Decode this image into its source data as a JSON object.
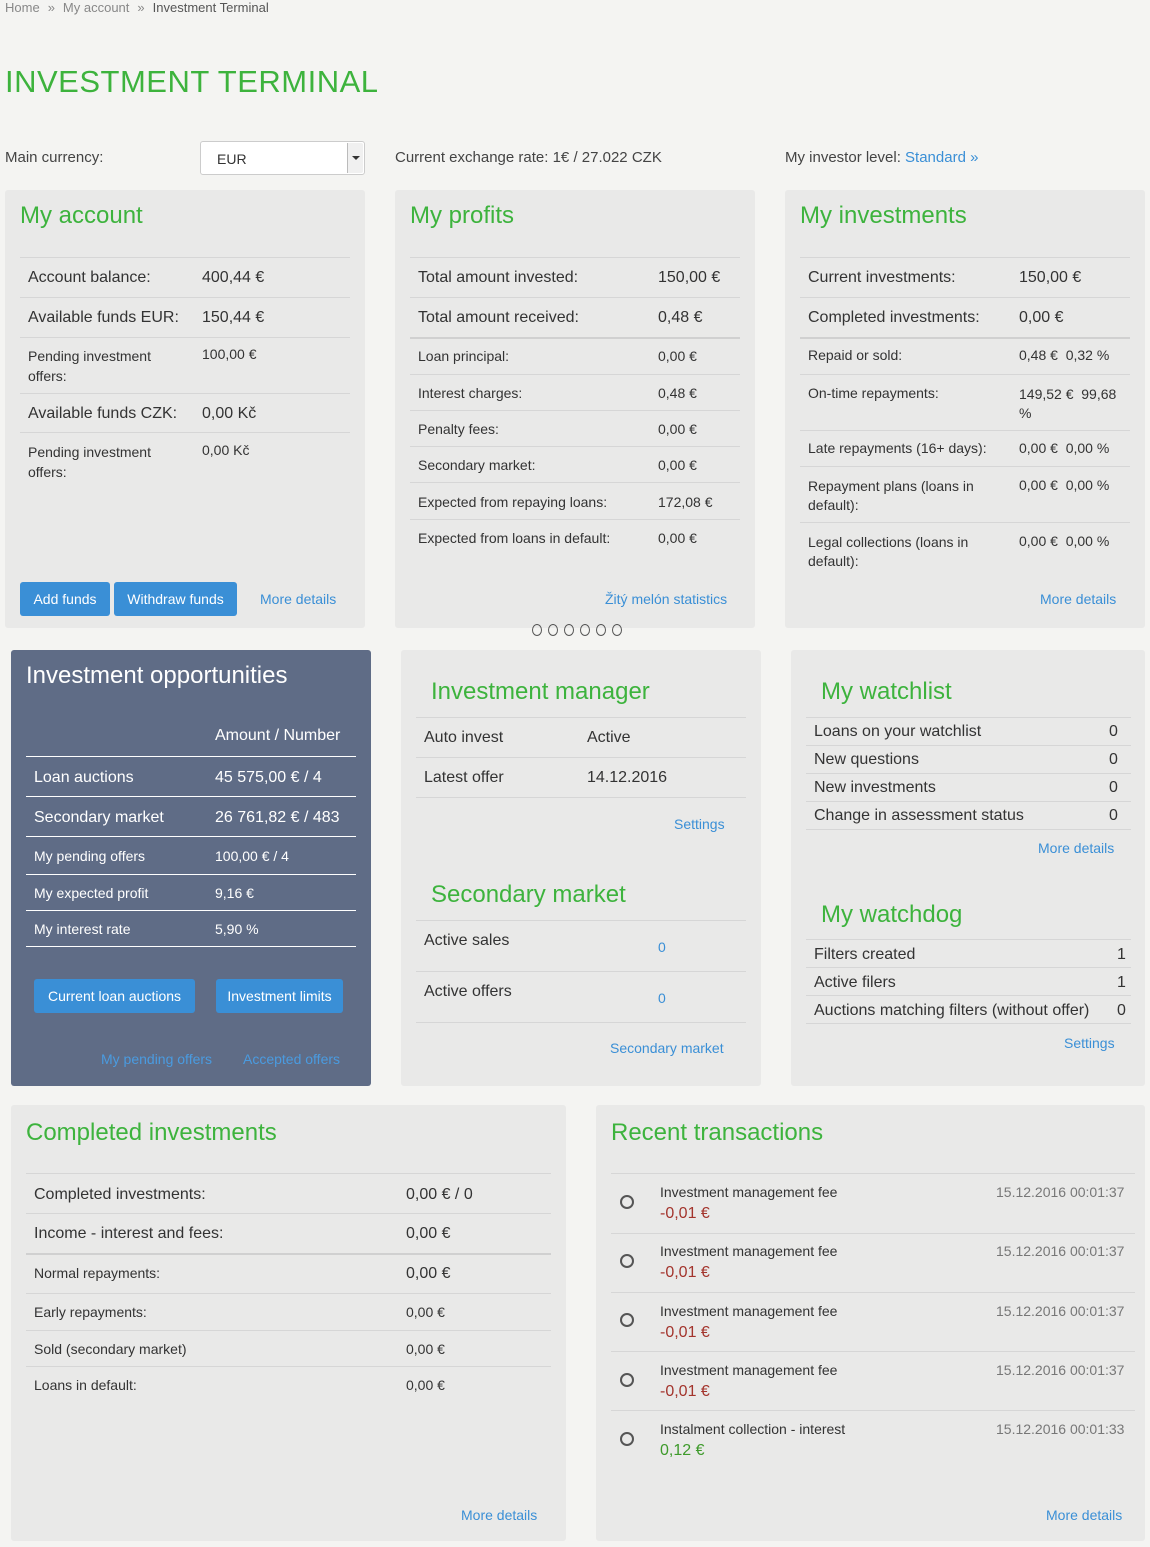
{
  "breadcrumb": {
    "home": "Home",
    "sep": "»",
    "account": "My account",
    "current": "Investment Terminal"
  },
  "page_title": "INVESTMENT TERMINAL",
  "currency": {
    "label": "Main currency:",
    "value": "EUR"
  },
  "exchange_rate": "Current exchange rate: 1€ / 27.022 CZK",
  "investor_level": {
    "label": "My investor level:",
    "value": "Standard »"
  },
  "my_account": {
    "title": "My account",
    "rows": [
      {
        "label": "Account balance:",
        "value": "400,44 €"
      },
      {
        "label": "Available funds EUR:",
        "value": "150,44 €"
      },
      {
        "label": "Pending investment offers:",
        "value": "100,00 €"
      },
      {
        "label": "Available funds CZK:",
        "value": "0,00 Kč"
      },
      {
        "label": "Pending investment offers:",
        "value": "0,00 Kč"
      }
    ],
    "add_funds": "Add funds",
    "withdraw_funds": "Withdraw funds",
    "more_details": "More details"
  },
  "my_profits": {
    "title": "My profits",
    "rows": [
      {
        "label": "Total amount invested:",
        "value": "150,00 €"
      },
      {
        "label": "Total amount received:",
        "value": "0,48 €"
      },
      {
        "label": "Loan principal:",
        "value": "0,00 €"
      },
      {
        "label": "Interest charges:",
        "value": "0,48 €"
      },
      {
        "label": "Penalty fees:",
        "value": "0,00 €"
      },
      {
        "label": "Secondary market:",
        "value": "0,00 €"
      },
      {
        "label": "Expected from repaying loans:",
        "value": "172,08 €"
      },
      {
        "label": "Expected from loans in default:",
        "value": "0,00 €"
      }
    ],
    "stats_link": "Žitý melón statistics"
  },
  "my_investments": {
    "title": "My investments",
    "rows": [
      {
        "label": "Current investments:",
        "value": "150,00 €"
      },
      {
        "label": "Completed investments:",
        "value": "0,00 €"
      },
      {
        "label": "Repaid or sold:",
        "value": "0,48 €  0,32 %"
      },
      {
        "label": "On-time repayments:",
        "value": "149,52 €  99,68 %"
      },
      {
        "label": "Late repayments (16+ days):",
        "value": "0,00 €  0,00 %"
      },
      {
        "label": "Repayment plans (loans in default):",
        "value": "0,00 €  0,00 %"
      },
      {
        "label": "Legal collections (loans in default):",
        "value": "0,00 €  0,00 %"
      }
    ],
    "more_details": "More details"
  },
  "opportunities": {
    "title": "Investment opportunities",
    "col_header": "Amount / Number",
    "rows": [
      {
        "label": "Loan auctions",
        "value": "45 575,00 € / 4"
      },
      {
        "label": "Secondary market",
        "value": "26 761,82 € / 483"
      },
      {
        "label": "My pending offers",
        "value": "100,00 € / 4"
      },
      {
        "label": "My expected profit",
        "value": "9,16 €"
      },
      {
        "label": "My interest rate",
        "value": "5,90 %"
      }
    ],
    "btn_auctions": "Current loan auctions",
    "btn_limits": "Investment limits",
    "link_pending": "My pending offers",
    "link_accepted": "Accepted offers"
  },
  "investment_manager": {
    "title": "Investment manager",
    "rows": [
      {
        "label": "Auto invest",
        "value": "Active"
      },
      {
        "label": "Latest offer",
        "value": "14.12.2016"
      }
    ],
    "settings": "Settings"
  },
  "secondary_market": {
    "title": "Secondary market",
    "rows": [
      {
        "label": "Active sales",
        "value": "0"
      },
      {
        "label": "Active offers",
        "value": "0"
      }
    ],
    "link": "Secondary market"
  },
  "watchlist": {
    "title": "My watchlist",
    "rows": [
      {
        "label": "Loans on your watchlist",
        "value": "0"
      },
      {
        "label": "New questions",
        "value": "0"
      },
      {
        "label": "New investments",
        "value": "0"
      },
      {
        "label": "Change in assessment status",
        "value": "0"
      }
    ],
    "more_details": "More details"
  },
  "watchdog": {
    "title": "My watchdog",
    "rows": [
      {
        "label": "Filters created",
        "value": "1"
      },
      {
        "label": "Active filers",
        "value": "1"
      },
      {
        "label": "Auctions matching filters (without offer)",
        "value": "0"
      }
    ],
    "settings": "Settings"
  },
  "completed": {
    "title": "Completed investments",
    "rows": [
      {
        "label": "Completed investments:",
        "value": "0,00 € / 0"
      },
      {
        "label": "Income - interest and fees:",
        "value": "0,00 €"
      },
      {
        "label": "Normal repayments:",
        "value": "0,00 €"
      },
      {
        "label": "Early repayments:",
        "value": "0,00 €"
      },
      {
        "label": "Sold (secondary market)",
        "value": "0,00 €"
      },
      {
        "label": "Loans in default:",
        "value": "0,00 €"
      }
    ],
    "more_details": "More details"
  },
  "transactions": {
    "title": "Recent transactions",
    "items": [
      {
        "name": "Investment management fee",
        "amount": "-0,01 €",
        "date": "15.12.2016 00:01:37"
      },
      {
        "name": "Investment management fee",
        "amount": "-0,01 €",
        "date": "15.12.2016 00:01:37"
      },
      {
        "name": "Investment management fee",
        "amount": "-0,01 €",
        "date": "15.12.2016 00:01:37"
      },
      {
        "name": "Investment management fee",
        "amount": "-0,01 €",
        "date": "15.12.2016 00:01:37"
      },
      {
        "name": "Instalment collection - interest",
        "amount": "0,12 €",
        "date": "15.12.2016 00:01:33"
      }
    ],
    "more_details": "More details"
  },
  "colors": {
    "accent_green": "#3db33d",
    "link_blue": "#3a8fd6",
    "panel_dark": "#5f6c86",
    "negative": "#a3342c",
    "positive": "#3d9a2a"
  }
}
